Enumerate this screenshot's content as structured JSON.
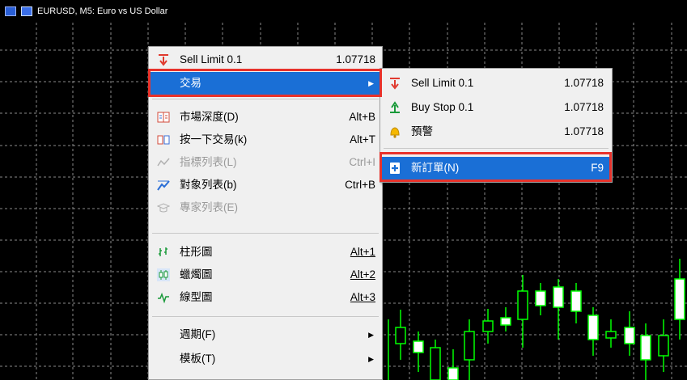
{
  "window": {
    "title": "EURUSD, M5: Euro vs US Dollar"
  },
  "context_menu": {
    "items": [
      {
        "label": "Sell Limit 0.1",
        "right": "1.07718",
        "icon": "sell-limit-icon"
      },
      {
        "label": "交易",
        "arrow": "▶",
        "selected": true
      },
      {
        "label": "市場深度(D)",
        "right": "Alt+B",
        "icon": "depth-of-market-icon"
      },
      {
        "label": "按一下交易(k)",
        "right": "Alt+T",
        "icon": "one-click-trading-icon"
      },
      {
        "label": "指標列表(L)",
        "right": "Ctrl+I",
        "icon": "indicators-list-icon",
        "disabled": true
      },
      {
        "label": "對象列表(b)",
        "right": "Ctrl+B",
        "icon": "objects-list-icon"
      },
      {
        "label": "專家列表(E)",
        "icon": "experts-list-icon",
        "disabled": true
      },
      {
        "label": "柱形圖",
        "right": "Alt+1",
        "icon": "bar-chart-icon"
      },
      {
        "label": "蠟燭圖",
        "right": "Alt+2",
        "icon": "candlestick-icon"
      },
      {
        "label": "線型圖",
        "right": "Alt+3",
        "icon": "line-chart-icon"
      },
      {
        "label": "週期(F)",
        "arrow": "▶"
      },
      {
        "label": "模板(T)",
        "arrow": "▶"
      }
    ]
  },
  "submenu": {
    "items": [
      {
        "label": "Sell Limit 0.1",
        "right": "1.07718",
        "icon": "sell-limit-icon"
      },
      {
        "label": "Buy Stop 0.1",
        "right": "1.07718",
        "icon": "buy-stop-icon"
      },
      {
        "label": "預警",
        "right": "1.07718",
        "icon": "alert-bell-icon"
      },
      {
        "label": "新訂單(N)",
        "right": "F9",
        "icon": "new-order-icon",
        "selected": true
      }
    ]
  },
  "colors": {
    "chart_background": "#000000",
    "grid": "#8a8a8a",
    "bull_candle": "#ffffff",
    "wick": "#00ff00",
    "menu_background": "#f0f0f0",
    "menu_selected": "#1a6fd6",
    "highlight_box": "#e8322b",
    "sell_icon": "#e03a2e",
    "buy_icon": "#1a9a3a"
  }
}
